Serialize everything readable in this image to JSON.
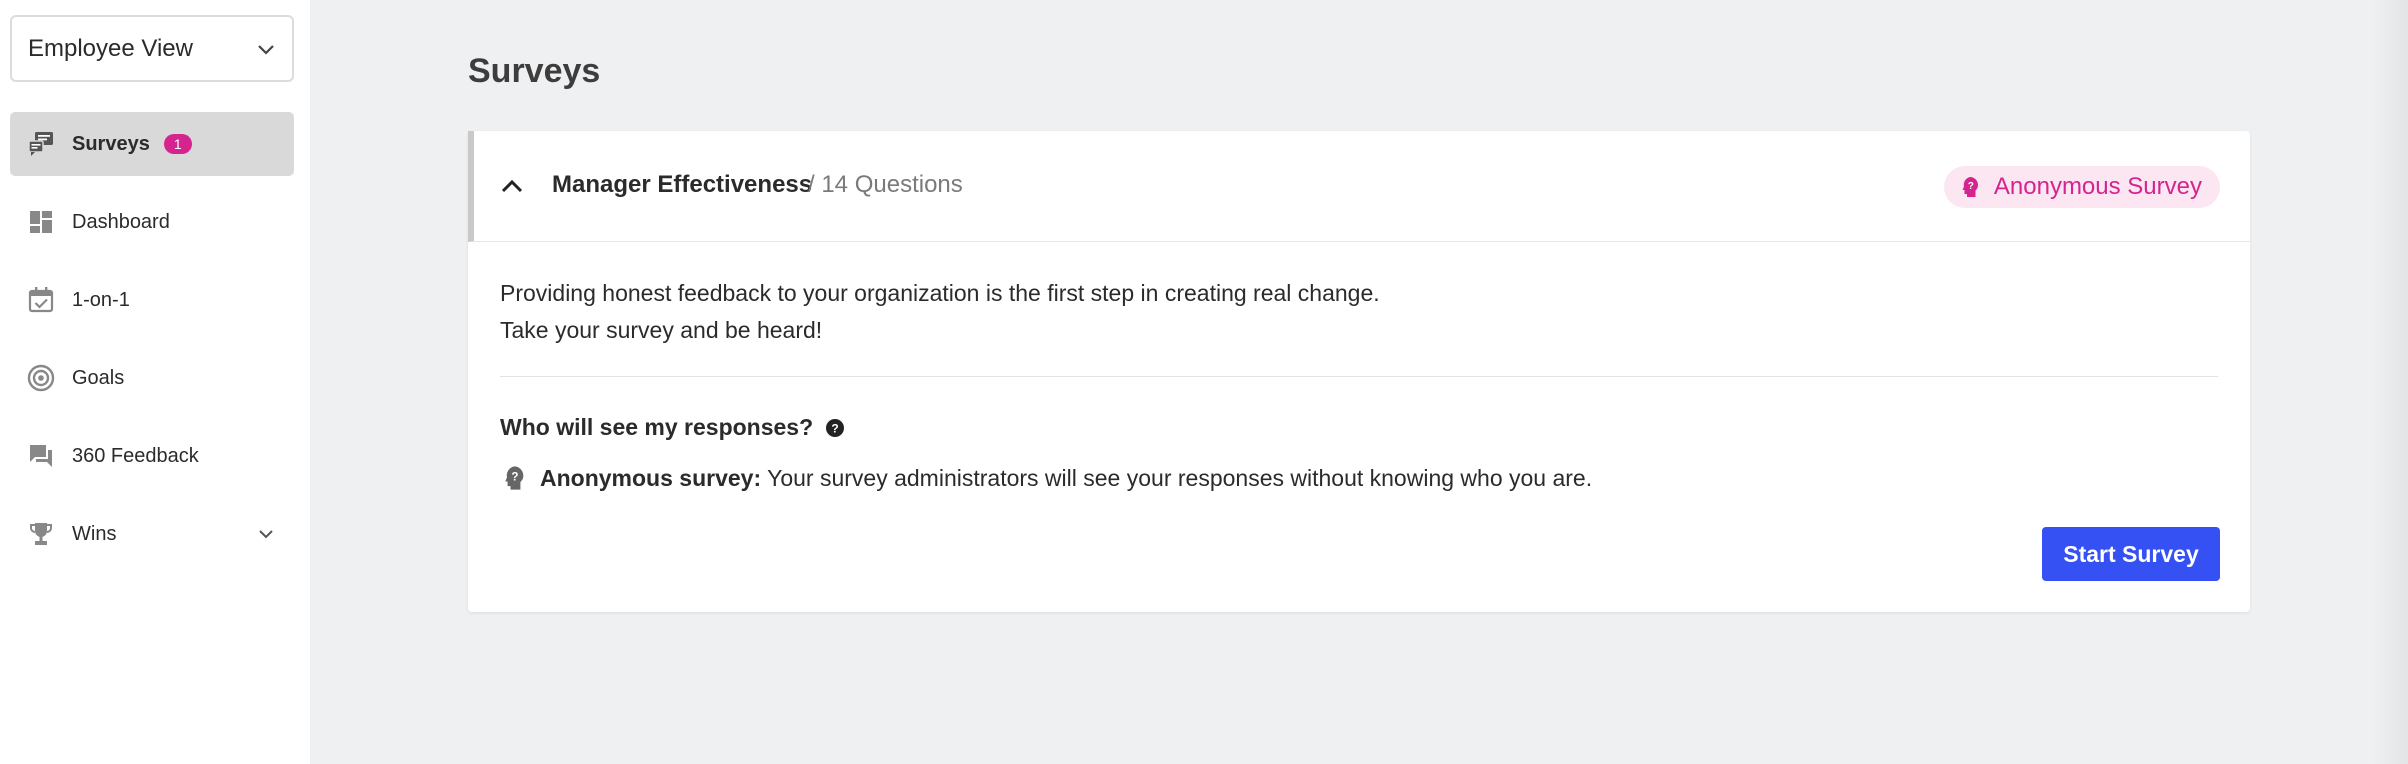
{
  "sidebar": {
    "view_select": "Employee View",
    "items": [
      {
        "label": "Surveys",
        "icon": "survey-chat-icon",
        "badge": "1",
        "active": true
      },
      {
        "label": "Dashboard",
        "icon": "dashboard-icon"
      },
      {
        "label": "1-on-1",
        "icon": "calendar-check-icon"
      },
      {
        "label": "Goals",
        "icon": "target-icon"
      },
      {
        "label": "360 Feedback",
        "icon": "feedback-chat-icon"
      },
      {
        "label": "Wins",
        "icon": "trophy-icon",
        "expandable": true
      }
    ]
  },
  "main": {
    "title": "Surveys",
    "survey": {
      "name": "Manager Effectiveness",
      "question_count": "/ 14 Questions",
      "anonymous_label": "Anonymous Survey",
      "intro_line1": "Providing honest feedback to your organization is the first step in creating real change.",
      "intro_line2": "Take your survey and be heard!",
      "who_heading": "Who will see my responses?",
      "anonymous_prefix": "Anonymous survey:",
      "anonymous_text": "Your survey administrators will see your responses without knowing who you are.",
      "start_button": "Start Survey"
    }
  },
  "colors": {
    "accent_pink": "#d6248e",
    "primary_button": "#3551f3",
    "page_bg": "#eff0f2"
  }
}
